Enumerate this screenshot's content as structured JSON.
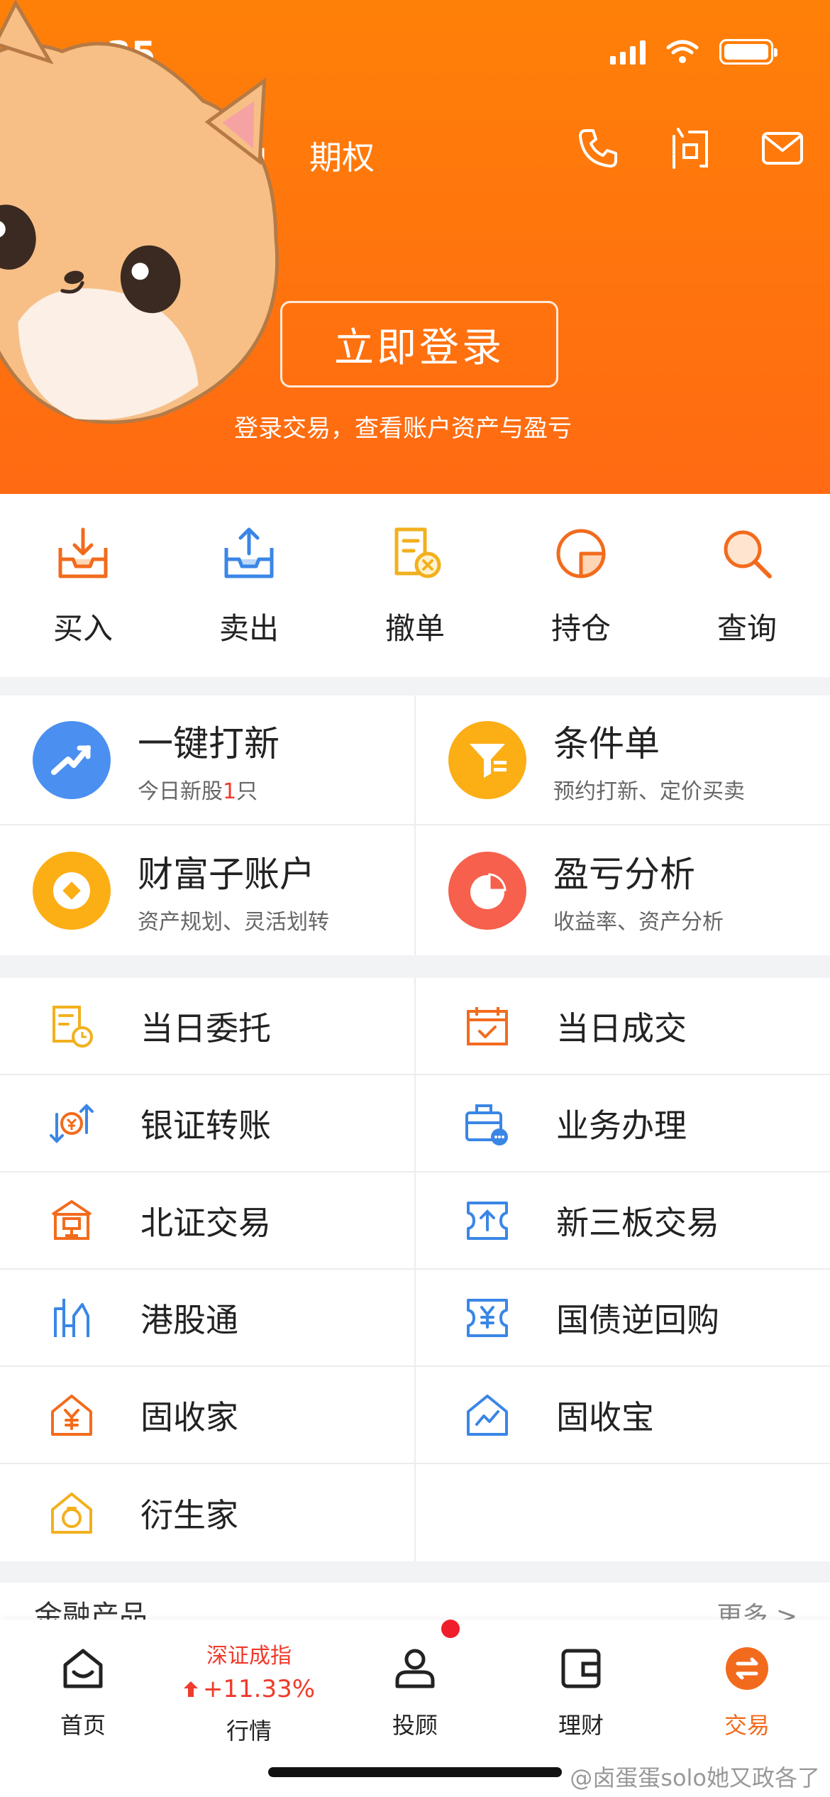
{
  "status_bar": {
    "time": "35"
  },
  "header": {
    "tabs": [
      "融",
      "期权"
    ],
    "icons": [
      "phone-icon",
      "ask-icon",
      "mail-icon"
    ],
    "login_button": "立即登录",
    "login_hint": "登录交易，查看账户资产与盈亏"
  },
  "quick_actions": [
    {
      "label": "买入",
      "icon": "buy-icon"
    },
    {
      "label": "卖出",
      "icon": "sell-icon"
    },
    {
      "label": "撤单",
      "icon": "cancel-order-icon"
    },
    {
      "label": "持仓",
      "icon": "position-icon"
    },
    {
      "label": "查询",
      "icon": "search-icon"
    }
  ],
  "features": [
    {
      "title": "一键打新",
      "sub_prefix": "今日新股",
      "sub_highlight": "1",
      "sub_suffix": "只",
      "icon": "ipo-icon"
    },
    {
      "title": "条件单",
      "sub_prefix": "预约打新、定价买卖",
      "sub_highlight": "",
      "sub_suffix": "",
      "icon": "condition-order-icon"
    },
    {
      "title": "财富子账户",
      "sub_prefix": "资产规划、灵活划转",
      "sub_highlight": "",
      "sub_suffix": "",
      "icon": "wealth-account-icon"
    },
    {
      "title": "盈亏分析",
      "sub_prefix": "收益率、资产分析",
      "sub_highlight": "",
      "sub_suffix": "",
      "icon": "pnl-analysis-icon"
    }
  ],
  "menu": [
    {
      "label": "当日委托",
      "icon": "today-orders-icon"
    },
    {
      "label": "当日成交",
      "icon": "today-deals-icon"
    },
    {
      "label": "银证转账",
      "icon": "bank-transfer-icon"
    },
    {
      "label": "业务办理",
      "icon": "business-icon"
    },
    {
      "label": "北证交易",
      "icon": "bse-icon"
    },
    {
      "label": "新三板交易",
      "icon": "neeq-icon"
    },
    {
      "label": "港股通",
      "icon": "hk-connect-icon"
    },
    {
      "label": "国债逆回购",
      "icon": "repo-icon"
    },
    {
      "label": "固收家",
      "icon": "fixed-income-home-icon"
    },
    {
      "label": "固收宝",
      "icon": "fixed-income-treasure-icon"
    },
    {
      "label": "衍生家",
      "icon": "derivatives-icon"
    }
  ],
  "section": {
    "title": "金融产品",
    "more": "更多 >"
  },
  "tabbar": {
    "home": "首页",
    "market": "行情",
    "market_index_name": "深证成指",
    "market_index_value": "+11.33%",
    "advisor": "投顾",
    "wealth": "理财",
    "trade": "交易"
  },
  "watermark": "@卤蛋蛋solo她又政各了",
  "colors": {
    "brand": "#ff7a0d",
    "accent_red": "#f03a2b",
    "blue": "#3a86e6"
  }
}
